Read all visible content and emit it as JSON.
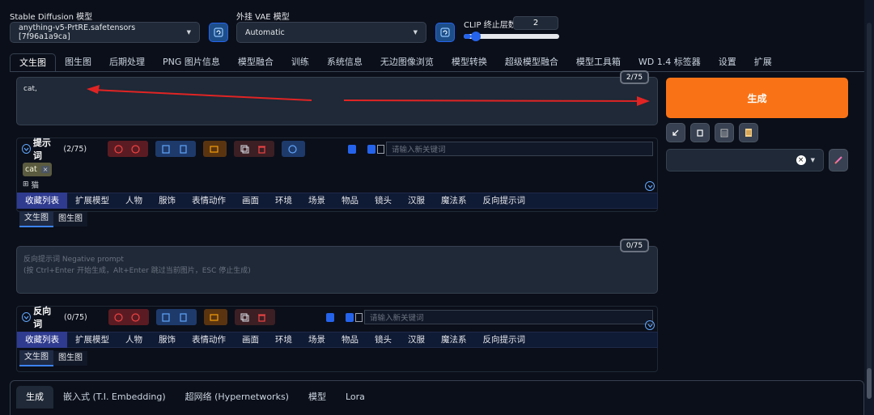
{
  "top": {
    "model_label": "Stable Diffusion 模型",
    "model_value": "anything-v5-PrtRE.safetensors [7f96a1a9ca]",
    "vae_label": "外挂 VAE 模型",
    "vae_value": "Automatic",
    "clip_label": "CLIP 终止层数",
    "clip_value": "2",
    "clip_fraction": 0.08
  },
  "tabs": [
    "文生图",
    "图生图",
    "后期处理",
    "PNG 图片信息",
    "模型融合",
    "训练",
    "系统信息",
    "无边图像浏览",
    "模型转换",
    "超级模型融合",
    "模型工具箱",
    "WD 1.4 标签器",
    "设置",
    "扩展"
  ],
  "prompt": {
    "text": "cat,",
    "counter": "2/75"
  },
  "generate_label": "生成",
  "positive": {
    "title": "提示词",
    "count": "(2/75)",
    "keyword_placeholder": "请输入新关键词",
    "tag": "cat",
    "tag_close": "×",
    "translation": "猫"
  },
  "categories": [
    "收藏列表",
    "扩展模型",
    "人物",
    "服饰",
    "表情动作",
    "画面",
    "环境",
    "场景",
    "物品",
    "镜头",
    "汉服",
    "魔法系",
    "反向提示词"
  ],
  "subtabs": [
    "文生图",
    "图生图"
  ],
  "negative_prompt": {
    "placeholder_line1": "反向提示词 Negative prompt",
    "placeholder_line2": "(按 Ctrl+Enter 开始生成，Alt+Enter 跳过当前图片，ESC 停止生成)",
    "counter": "0/75"
  },
  "negative": {
    "title": "反向词",
    "count": "(0/75)",
    "keyword_placeholder": "请输入新关键词"
  },
  "bottom_tabs": [
    "生成",
    "嵌入式 (T.I. Embedding)",
    "超网络 (Hypernetworks)",
    "模型",
    "Lora"
  ],
  "colors": {
    "accent": "#f97316",
    "background": "#0b0f19"
  }
}
